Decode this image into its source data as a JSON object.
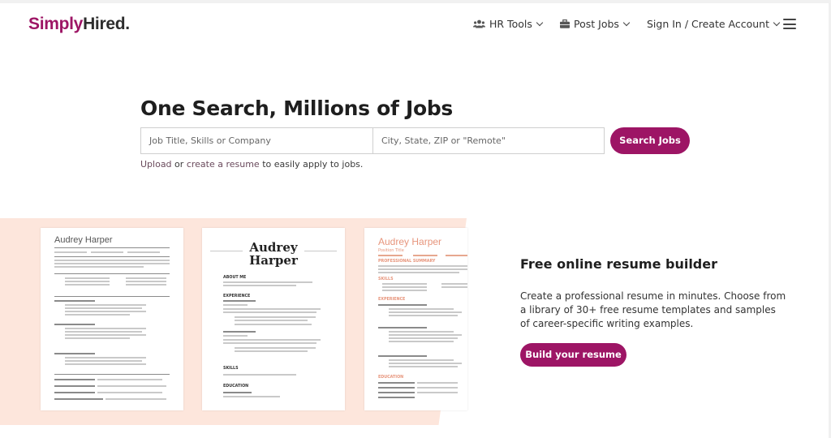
{
  "brand": {
    "part1": "Simply",
    "part2": "Hired",
    "dot": "."
  },
  "nav": {
    "hr_tools": "HR Tools",
    "post_jobs": "Post Jobs",
    "sign_in": "Sign In / Create Account"
  },
  "hero": {
    "title": "One Search, Millions of Jobs",
    "job_placeholder": "Job Title, Skills or Company",
    "location_placeholder": "City, State, ZIP or \"Remote\"",
    "search_button": "Search Jobs",
    "upload_link": "Upload",
    "or_text": "or",
    "create_link": "create a resume",
    "tail_text": "to easily apply to jobs."
  },
  "resumes": {
    "doc1_name": "Audrey Harper",
    "doc2_first": "Audrey",
    "doc2_last": "Harper",
    "doc2_section_about": "ABOUT ME",
    "doc2_section_exp": "EXPERIENCE",
    "doc2_section_skills": "SKILLS",
    "doc2_section_edu": "EDUCATION",
    "doc3_name": "Audrey Harper",
    "doc3_sub": "Position Title",
    "doc3_section_summary": "PROFESSIONAL SUMMARY",
    "doc3_section_skills": "SKILLS",
    "doc3_section_exp": "EXPERIENCE",
    "doc3_section_edu": "EDUCATION"
  },
  "promo": {
    "title": "Free online resume builder",
    "text": "Create a professional resume in minutes. Choose from a library of 30+ free resume templates and samples of career-specific writing examples.",
    "button": "Build your resume"
  },
  "colors": {
    "accent": "#9d1565",
    "band": "#fde6dc",
    "resume_accent": "#e7957c"
  }
}
